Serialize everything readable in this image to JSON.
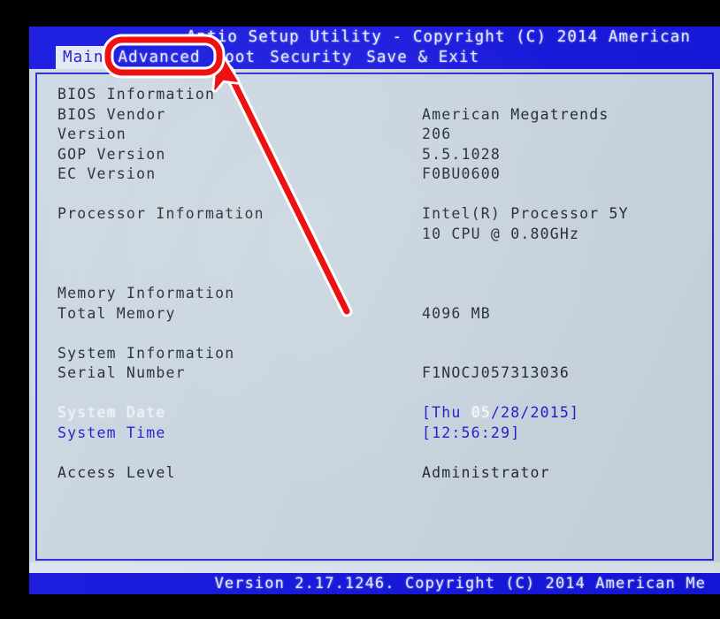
{
  "header": {
    "title": "Aptio Setup Utility - Copyright (C) 2014 American",
    "tabs": [
      {
        "label": "Main",
        "selected": true
      },
      {
        "label": "Advanced",
        "selected": false
      },
      {
        "label": "Boot",
        "selected": false
      },
      {
        "label": "Security",
        "selected": false
      },
      {
        "label": "Save & Exit",
        "selected": false
      }
    ]
  },
  "main": {
    "sections": {
      "bios_information": {
        "heading": "BIOS Information",
        "rows": [
          {
            "label": "BIOS Vendor",
            "value": "American Megatrends"
          },
          {
            "label": "Version",
            "value": "206"
          },
          {
            "label": "GOP Version",
            "value": "5.5.1028"
          },
          {
            "label": "EC Version",
            "value": "F0BU0600"
          }
        ]
      },
      "processor_information": {
        "heading": "Processor Information",
        "value_line1": "Intel(R) Processor 5Y",
        "value_line2": "10 CPU @ 0.80GHz"
      },
      "memory_information": {
        "heading": "Memory Information",
        "rows": [
          {
            "label": "Total Memory",
            "value": "4096 MB"
          }
        ]
      },
      "system_information": {
        "heading": "System Information",
        "rows": [
          {
            "label": "Serial Number",
            "value": "F1NOCJ057313036"
          }
        ]
      },
      "date_time": {
        "date_label": "System Date",
        "date_open_bracket": "[",
        "date_weekday": "Thu ",
        "date_month_highlighted": "05",
        "date_rest": "/28/2015",
        "date_close_bracket": "]",
        "time_label": "System Time",
        "time_value": "[12:56:29]"
      },
      "access": {
        "label": "Access Level",
        "value": "Administrator"
      }
    }
  },
  "footer": {
    "version_text": "Version 2.17.1246. Copyright (C) 2014 American Me"
  },
  "annotation": {
    "highlight_target": "Advanced",
    "color": "#ee1111",
    "outline_color": "#ffffff"
  },
  "colors": {
    "header_blue": "#1515e0",
    "screen_bg": "#cdd9e4",
    "panel_border": "#2a2ad8",
    "text_dark": "#23282f",
    "text_blue": "#1b1bd2",
    "text_white": "#f2f6fb",
    "annotation_red": "#ee1111",
    "frame_black": "#000000"
  }
}
